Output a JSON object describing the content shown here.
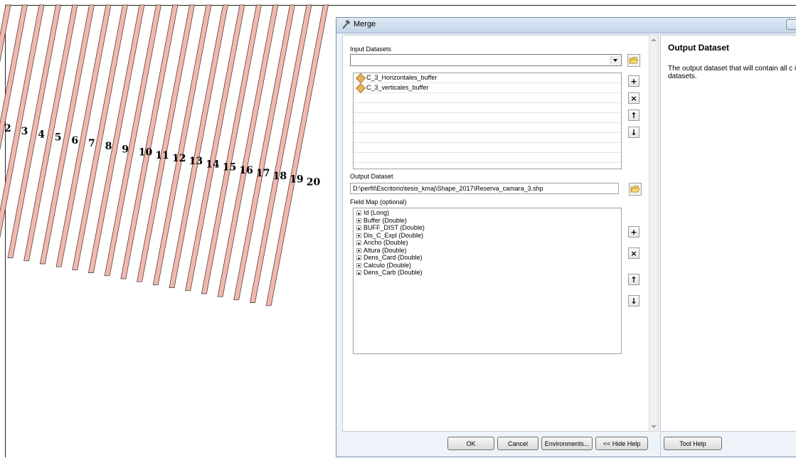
{
  "map": {
    "strip_labels": [
      "2",
      "3",
      "4",
      "5",
      "6",
      "7",
      "8",
      "9",
      "10",
      "11",
      "12",
      "13",
      "14",
      "15",
      "16",
      "17",
      "18",
      "19",
      "20"
    ]
  },
  "dialog": {
    "title": "Merge",
    "input_datasets": {
      "label": "Input Datasets",
      "combo_value": "",
      "items": [
        "C_3_Horizontales_buffer",
        "C_3_verticales_buffer"
      ]
    },
    "output_dataset": {
      "label": "Output Dataset",
      "value": "D:\\perfil\\Escritorio\\tesis_kmaj\\Shape_2017\\Reserva_camara_3.shp"
    },
    "field_map": {
      "label": "Field Map (optional)",
      "fields": [
        "Id (Long)",
        "Buffer (Double)",
        "BUFF_DIST (Double)",
        "Dis_C_Expl (Double)",
        "Ancho (Double)",
        "Altura (Double)",
        "Dens_Card (Double)",
        "Calculo (Double)",
        "Dens_Carb (Double)"
      ]
    },
    "side_buttons": {
      "add": "+",
      "remove": "×",
      "up": "↑",
      "down": "↓"
    },
    "help": {
      "title": "Output Dataset",
      "text": "The output dataset that will contain all c input datasets."
    },
    "buttons": {
      "ok": "OK",
      "cancel": "Cancel",
      "environments": "Environments...",
      "hide_help": "<< Hide Help",
      "tool_help": "Tool Help"
    },
    "icons": {
      "title": "hammer-icon",
      "browse": "folder-open-icon",
      "layer": "feature-layer-icon"
    }
  }
}
